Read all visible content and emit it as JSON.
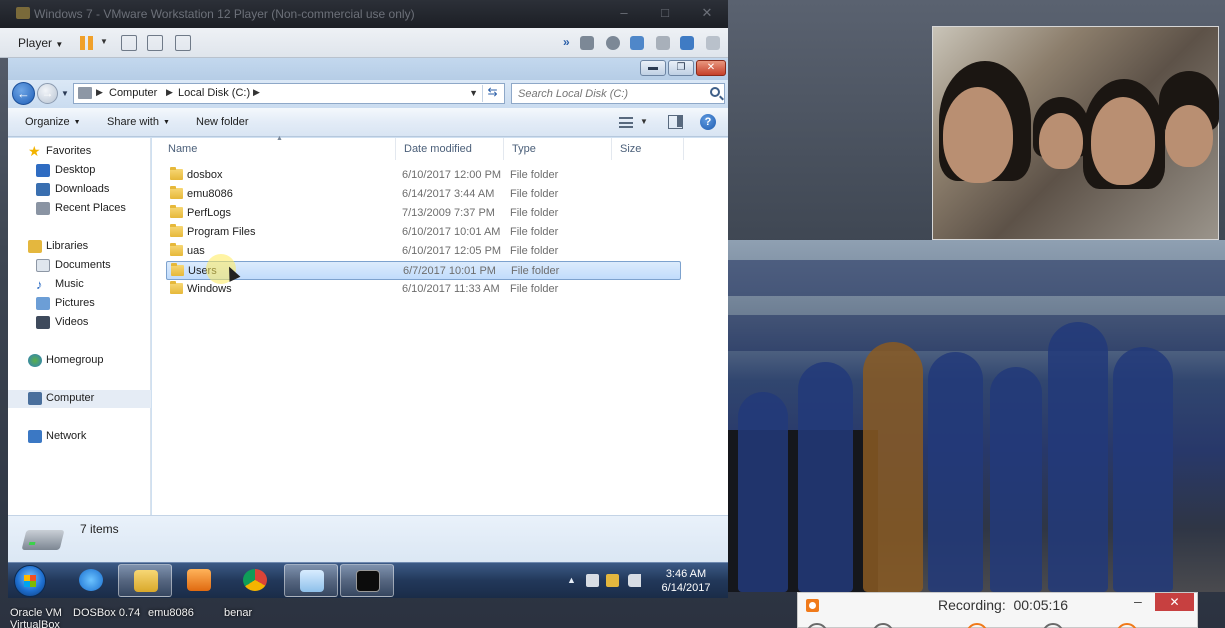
{
  "vmware": {
    "title": "Windows 7 - VMware Workstation 12 Player (Non-commercial use only)",
    "player_menu": "Player",
    "toolbar_icons": [
      "pause-icon",
      "send-ctrl-alt-del-icon",
      "fit-guest-icon",
      "unity-icon",
      "devices-icon",
      "removable-devices-icon"
    ]
  },
  "explorer": {
    "window_buttons": [
      "minimize",
      "maximize",
      "close"
    ],
    "breadcrumbs": [
      "Computer",
      "Local Disk (C:)"
    ],
    "search_placeholder": "Search Local Disk (C:)",
    "commands": {
      "organize": "Organize",
      "share_with": "Share with",
      "new_folder": "New folder"
    },
    "nav": {
      "favorites": "Favorites",
      "desktop": "Desktop",
      "downloads": "Downloads",
      "recent_places": "Recent Places",
      "libraries": "Libraries",
      "documents": "Documents",
      "music": "Music",
      "pictures": "Pictures",
      "videos": "Videos",
      "homegroup": "Homegroup",
      "computer": "Computer",
      "network": "Network"
    },
    "columns": {
      "name": "Name",
      "date_modified": "Date modified",
      "type": "Type",
      "size": "Size"
    },
    "files": [
      {
        "name": "dosbox",
        "date": "6/10/2017 12:00 PM",
        "type": "File folder"
      },
      {
        "name": "emu8086",
        "date": "6/14/2017 3:44 AM",
        "type": "File folder"
      },
      {
        "name": "PerfLogs",
        "date": "7/13/2009 7:37 PM",
        "type": "File folder"
      },
      {
        "name": "Program Files",
        "date": "6/10/2017 10:01 AM",
        "type": "File folder"
      },
      {
        "name": "uas",
        "date": "6/10/2017 12:05 PM",
        "type": "File folder"
      },
      {
        "name": "Users",
        "date": "6/7/2017 10:01 PM",
        "type": "File folder"
      },
      {
        "name": "Windows",
        "date": "6/10/2017 11:33 AM",
        "type": "File folder"
      }
    ],
    "selected_file": "Users",
    "status": "7 items"
  },
  "taskbar": {
    "apps": [
      "internet-explorer-icon",
      "windows-explorer-icon",
      "media-player-icon",
      "chrome-icon",
      "notepad-icon",
      "command-prompt-icon"
    ],
    "time": "3:46 AM",
    "date": "6/14/2017"
  },
  "host_desktop": {
    "labels": [
      "Oracle VM VirtualBox",
      "DOSBox 0.74",
      "emu8086",
      "benar"
    ]
  },
  "recorder": {
    "label": "Recording:",
    "elapsed": "00:05:16"
  },
  "colors": {
    "accent": "#1f5fb8",
    "selection": "#c1dcfc",
    "folder": "#e6b83a",
    "recorder_close": "#c74040"
  }
}
